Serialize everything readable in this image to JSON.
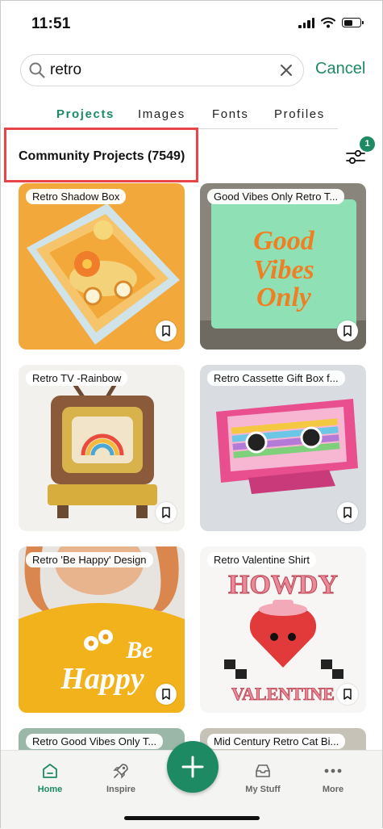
{
  "status": {
    "time": "11:51"
  },
  "search": {
    "value": "retro",
    "cancel_label": "Cancel"
  },
  "tabs": [
    {
      "label": "Projects",
      "active": true
    },
    {
      "label": "Images",
      "active": false
    },
    {
      "label": "Fonts",
      "active": false
    },
    {
      "label": "Profiles",
      "active": false
    }
  ],
  "section": {
    "title": "Community Projects (7549)",
    "filter_badge": "1"
  },
  "cards": [
    {
      "label": "Retro Shadow Box"
    },
    {
      "label": "Good Vibes Only Retro T..."
    },
    {
      "label": "Retro TV -Rainbow"
    },
    {
      "label": "Retro Cassette Gift Box f..."
    },
    {
      "label": "Retro 'Be Happy' Design"
    },
    {
      "label": "Retro Valentine Shirt"
    },
    {
      "label": "Retro Good Vibes Only T..."
    },
    {
      "label": "Mid Century Retro Cat Bi..."
    }
  ],
  "art_text": {
    "good_vibes_1": "Good",
    "good_vibes_2": "Vibes",
    "good_vibes_3": "Only",
    "be": "Be",
    "happy": "Happy",
    "howdy": "HOWDY",
    "valentine": "VALENTINE"
  },
  "nav": [
    {
      "label": "Home",
      "icon": "home-icon",
      "active": true
    },
    {
      "label": "Inspire",
      "icon": "rocket-icon",
      "active": false
    },
    {
      "label": "My Stuff",
      "icon": "inbox-icon",
      "active": false
    },
    {
      "label": "More",
      "icon": "more-dots-icon",
      "active": false
    }
  ],
  "colors": {
    "accent": "#1d8a63",
    "highlight_box": "#e8454a"
  }
}
